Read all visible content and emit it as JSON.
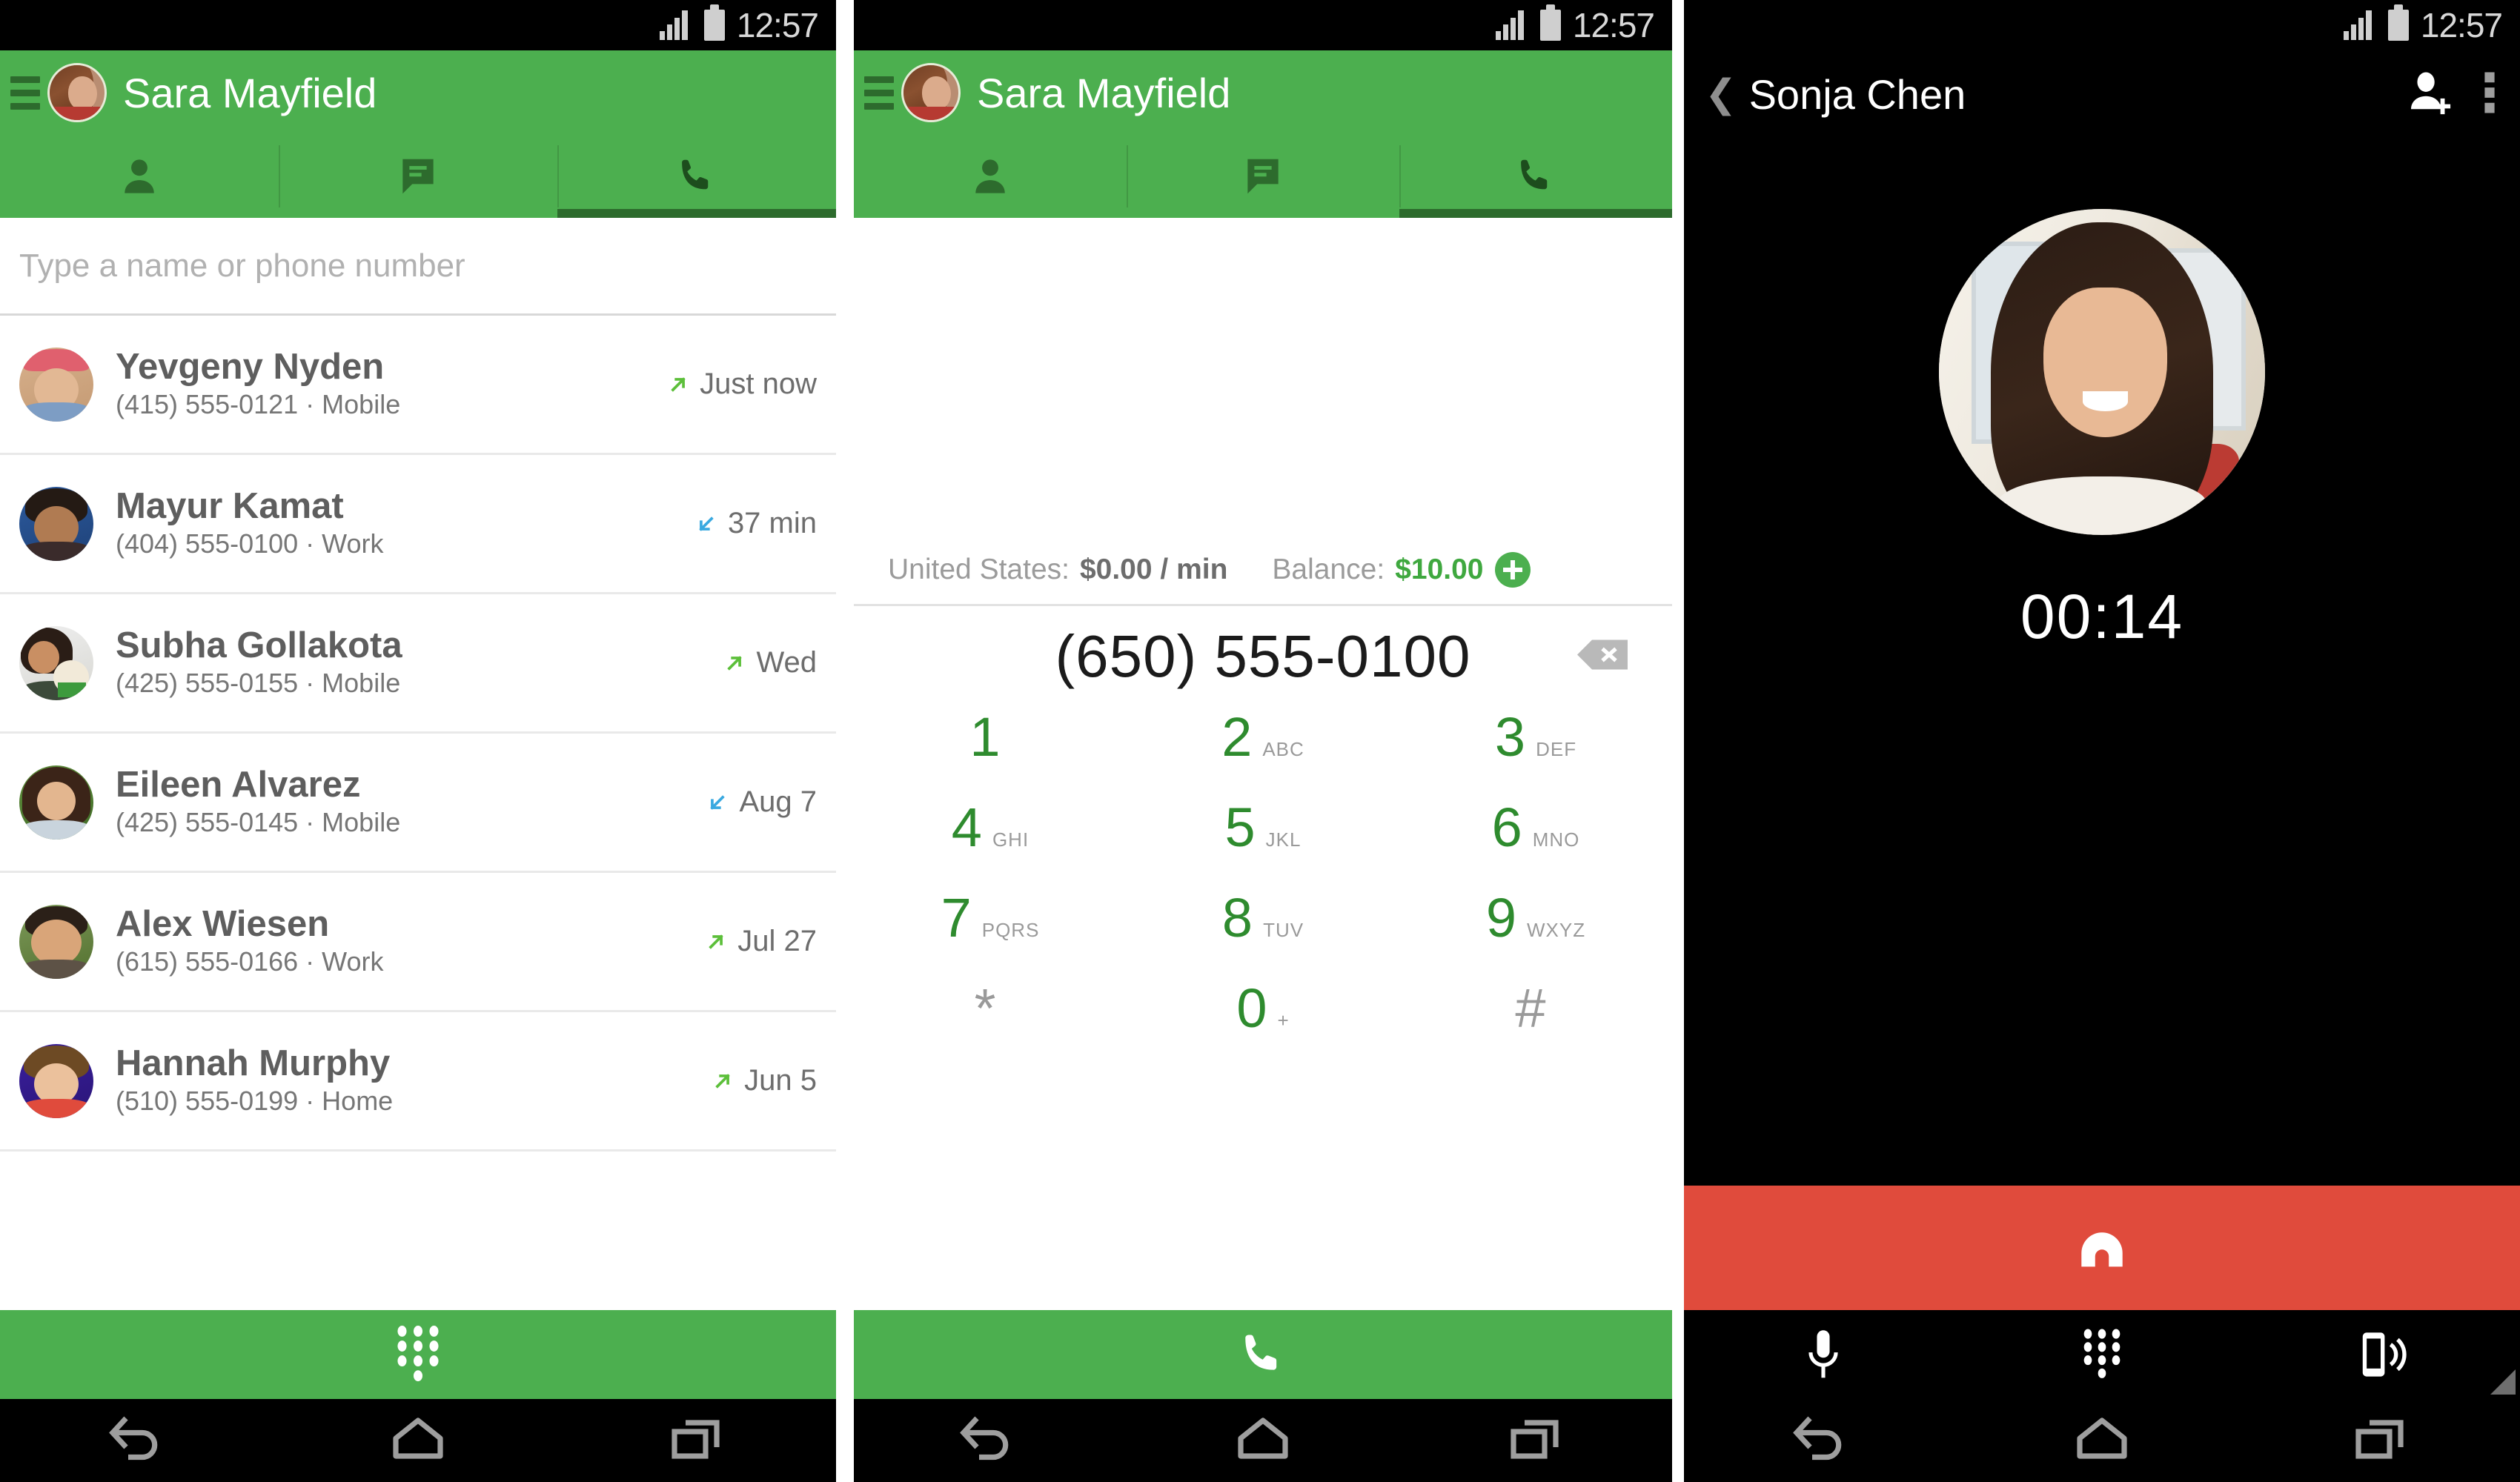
{
  "status_bar": {
    "time": "12:57",
    "signal_icon": "signal-bars-icon",
    "battery_icon": "battery-icon"
  },
  "colors": {
    "green_primary": "#4caf4f",
    "green_dark": "#2d6b2d",
    "green_digit": "#2e8b2e",
    "red_hangup": "#e04b3c",
    "blue_incoming": "#3aa9e0",
    "green_outgoing": "#5cbf3a"
  },
  "panel1": {
    "app_bar": {
      "menu_icon": "hamburger-menu-icon",
      "avatar": "user-avatar",
      "title": "Sara Mayfield"
    },
    "tabs": [
      {
        "name": "contacts",
        "icon": "person-icon",
        "selected": false
      },
      {
        "name": "messages",
        "icon": "chat-bubble-icon",
        "selected": false
      },
      {
        "name": "calls",
        "icon": "phone-handset-icon",
        "selected": true
      }
    ],
    "search": {
      "placeholder": "Type a name or phone number",
      "value": ""
    },
    "contacts": [
      {
        "name": "Yevgeny Nyden",
        "number": "(415) 555-0121 · Mobile",
        "time": "Just now",
        "direction": "outgoing"
      },
      {
        "name": "Mayur Kamat",
        "number": "(404) 555-0100 · Work",
        "time": "37 min",
        "direction": "incoming"
      },
      {
        "name": "Subha Gollakota",
        "number": "(425) 555-0155 · Mobile",
        "time": "Wed",
        "direction": "outgoing"
      },
      {
        "name": "Eileen Alvarez",
        "number": "(425) 555-0145 · Mobile",
        "time": "Aug 7",
        "direction": "incoming"
      },
      {
        "name": "Alex Wiesen",
        "number": "(615) 555-0166 · Work",
        "time": "Jul 27",
        "direction": "outgoing"
      },
      {
        "name": "Hannah Murphy",
        "number": "(510) 555-0199 · Home",
        "time": "Jun 5",
        "direction": "outgoing"
      }
    ],
    "fab": {
      "icon": "dialpad-icon",
      "label": ""
    },
    "nav": [
      {
        "name": "back",
        "icon": "back-arrow-icon"
      },
      {
        "name": "home",
        "icon": "home-icon"
      },
      {
        "name": "recents",
        "icon": "recents-icon"
      }
    ]
  },
  "panel2": {
    "app_bar": {
      "menu_icon": "hamburger-menu-icon",
      "avatar": "user-avatar",
      "title": "Sara Mayfield"
    },
    "tabs": [
      {
        "name": "contacts",
        "icon": "person-icon",
        "selected": false
      },
      {
        "name": "messages",
        "icon": "chat-bubble-icon",
        "selected": false
      },
      {
        "name": "calls",
        "icon": "phone-handset-icon",
        "selected": true
      }
    ],
    "rate_bar": {
      "country_label": "United States:",
      "rate_value": "$0.00 / min",
      "balance_label": "Balance:",
      "balance_value": "$10.00",
      "add_credit_icon": "plus-circle-icon"
    },
    "dialed_number": "(650) 555-0100",
    "backspace_icon": "backspace-icon",
    "keypad": [
      [
        {
          "digit": "1",
          "letters": ""
        },
        {
          "digit": "2",
          "letters": "ABC"
        },
        {
          "digit": "3",
          "letters": "DEF"
        }
      ],
      [
        {
          "digit": "4",
          "letters": "GHI"
        },
        {
          "digit": "5",
          "letters": "JKL"
        },
        {
          "digit": "6",
          "letters": "MNO"
        }
      ],
      [
        {
          "digit": "7",
          "letters": "PQRS"
        },
        {
          "digit": "8",
          "letters": "TUV"
        },
        {
          "digit": "9",
          "letters": "WXYZ"
        }
      ],
      [
        {
          "digit": "*",
          "letters": ""
        },
        {
          "digit": "0",
          "letters": "+"
        },
        {
          "digit": "#",
          "letters": ""
        }
      ]
    ],
    "call_button": {
      "icon": "phone-handset-icon",
      "label": ""
    },
    "nav": [
      {
        "name": "back",
        "icon": "back-arrow-icon"
      },
      {
        "name": "home",
        "icon": "home-icon"
      },
      {
        "name": "recents",
        "icon": "recents-icon"
      }
    ]
  },
  "panel3": {
    "header": {
      "back_icon": "chevron-left-icon",
      "contact_name": "Sonja Chen",
      "add_contact_icon": "add-person-icon",
      "overflow_icon": "overflow-menu-icon"
    },
    "contact_photo": "sonja-chen-photo",
    "call_duration": "00:14",
    "hangup_button": {
      "icon": "end-call-icon",
      "label": ""
    },
    "controls": [
      {
        "name": "mute",
        "icon": "microphone-icon"
      },
      {
        "name": "dialpad",
        "icon": "dialpad-icon"
      },
      {
        "name": "speaker",
        "icon": "speaker-phone-icon"
      }
    ],
    "resize_grip_icon": "resize-grip-icon",
    "nav": [
      {
        "name": "back",
        "icon": "back-arrow-icon"
      },
      {
        "name": "home",
        "icon": "home-icon"
      },
      {
        "name": "recents",
        "icon": "recents-icon"
      }
    ]
  }
}
